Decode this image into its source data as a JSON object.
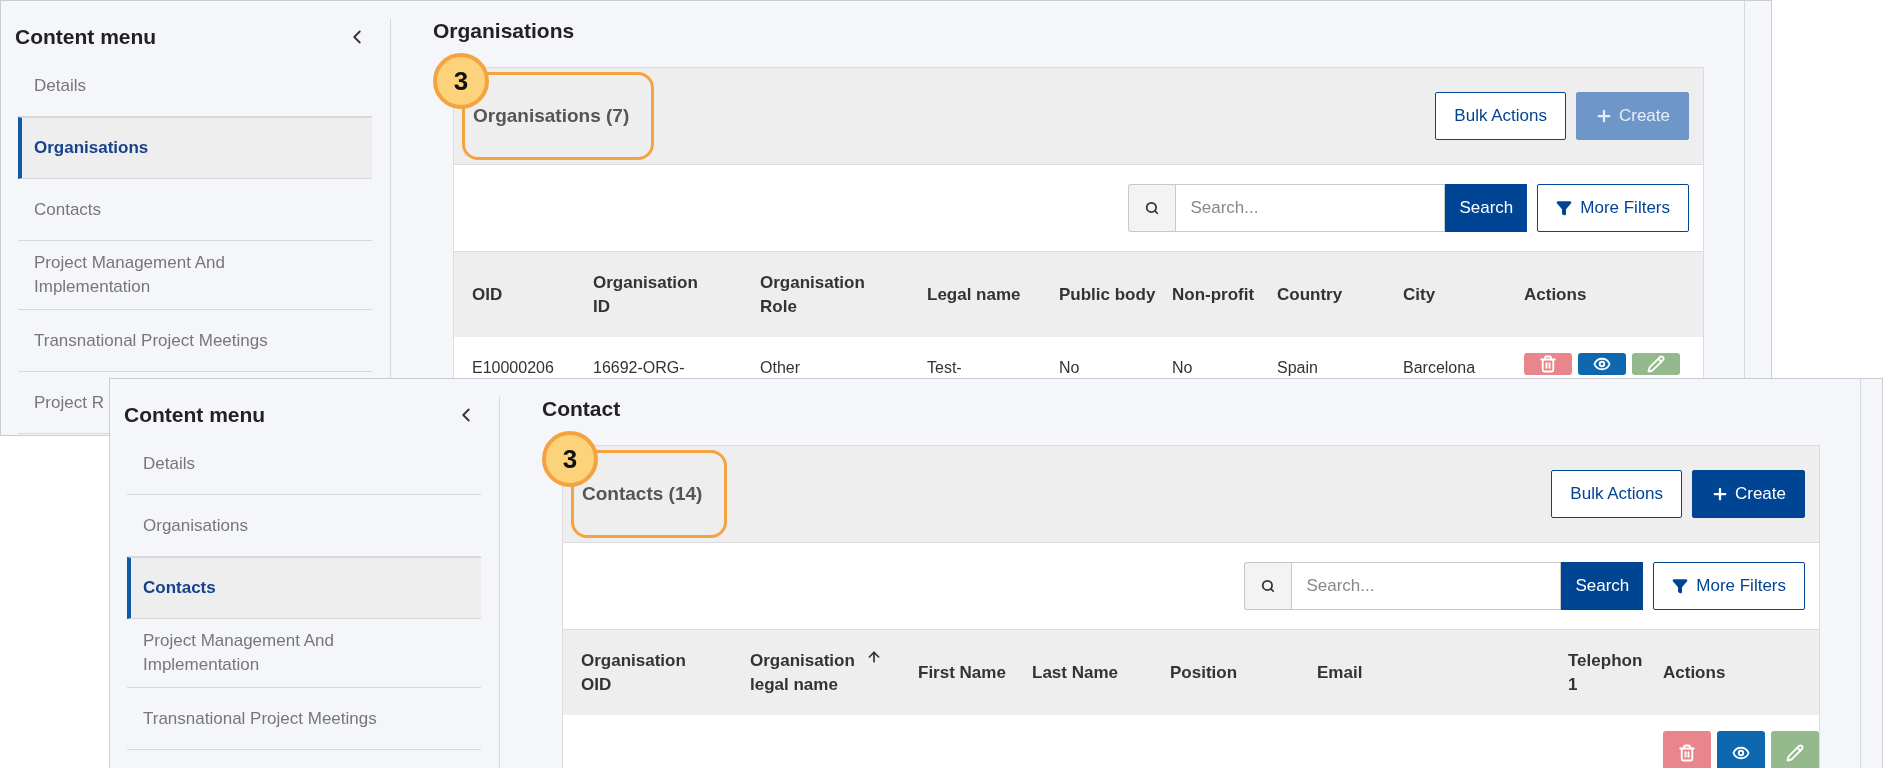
{
  "windows": [
    {
      "sidebar": {
        "title": "Content menu",
        "items": [
          {
            "label": "Details",
            "selected": false
          },
          {
            "label": "Organisations",
            "selected": true
          },
          {
            "label": "Contacts",
            "selected": false
          },
          {
            "label": "Project Management And Implementation",
            "selected": false
          },
          {
            "label": "Transnational Project Meetings",
            "selected": false
          },
          {
            "label": "Project R",
            "selected": false
          }
        ]
      },
      "page_title": "Organisations",
      "card": {
        "title": "Organisations (7)",
        "callout": "3",
        "buttons": [
          {
            "label": "Bulk Actions",
            "kind": "outline"
          },
          {
            "label": "Create",
            "kind": "primary",
            "disabled": true
          }
        ],
        "search": {
          "placeholder": "Search...",
          "button": "Search"
        },
        "filter_button": "More Filters",
        "table": {
          "columns": [
            {
              "label": "OID",
              "sorted": false
            },
            {
              "label": "Organisation ID",
              "sorted": false
            },
            {
              "label": "Organisation Role",
              "sorted": false
            },
            {
              "label": "Legal name",
              "sorted": false
            },
            {
              "label": "Public body",
              "sorted": false
            },
            {
              "label": "Non-profit",
              "sorted": false
            },
            {
              "label": "Country",
              "sorted": false
            },
            {
              "label": "City",
              "sorted": false
            },
            {
              "label": "Actions",
              "sorted": false
            }
          ],
          "rows": [
            {
              "cells": [
                "E10000206",
                "16692-ORG-",
                "Other",
                "Test-",
                "No",
                "No",
                "Spain",
                "Barcelona"
              ],
              "actions": [
                {
                  "kind": "delete"
                },
                {
                  "kind": "view"
                },
                {
                  "kind": "edit"
                }
              ]
            }
          ]
        }
      }
    },
    {
      "sidebar": {
        "title": "Content menu",
        "items": [
          {
            "label": "Details",
            "selected": false
          },
          {
            "label": "Organisations",
            "selected": false
          },
          {
            "label": "Contacts",
            "selected": true
          },
          {
            "label": "Project Management And Implementation",
            "selected": false
          },
          {
            "label": "Transnational Project Meetings",
            "selected": false
          }
        ]
      },
      "page_title": "Contact",
      "card": {
        "title": "Contacts (14)",
        "callout": "3",
        "buttons": [
          {
            "label": "Bulk Actions",
            "kind": "outline"
          },
          {
            "label": "Create",
            "kind": "primary",
            "disabled": false
          }
        ],
        "search": {
          "placeholder": "Search...",
          "button": "Search"
        },
        "filter_button": "More Filters",
        "table": {
          "columns": [
            {
              "label": "Organisation OID",
              "sorted": false
            },
            {
              "label": "Organisation legal name",
              "sorted": true
            },
            {
              "label": "First Name",
              "sorted": false
            },
            {
              "label": "Last Name",
              "sorted": false
            },
            {
              "label": "Position",
              "sorted": false
            },
            {
              "label": "Email",
              "sorted": false
            },
            {
              "label": "Telephon 1",
              "sorted": false
            },
            {
              "label": "Actions",
              "sorted": false
            }
          ],
          "rows": [
            {
              "actions": [
                {
                  "kind": "delete"
                },
                {
                  "kind": "view"
                },
                {
                  "kind": "edit"
                }
              ]
            }
          ]
        }
      }
    }
  ]
}
